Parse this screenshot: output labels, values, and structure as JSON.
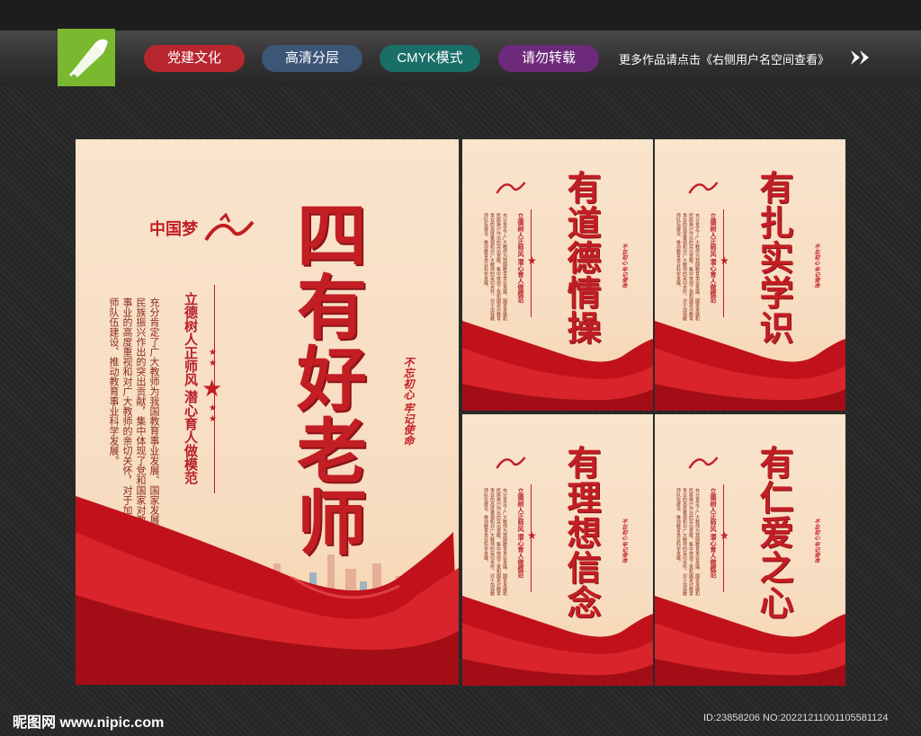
{
  "header": {
    "tags": [
      "党建文化",
      "高清分层",
      "CMYK模式",
      "请勿转载"
    ],
    "more_text": "更多作品请点击《右侧用户名空间查看》"
  },
  "main_poster": {
    "title": "四有好老师",
    "subtitle": "立德树人正师风  潜心育人做模范",
    "body": "充分肯定了广大教师为我国教育事业发展、国家发展和民族振兴作出的突出贡献，集中体现了党和国家对教育事业的高度重视和对广大教师的亲切关怀，对于加强教师队伍建设、推动教育事业科学发展。",
    "stamp": "不忘初心 牢记使命",
    "logo_text": "中国梦"
  },
  "small_posters": [
    {
      "title": "有道德情操",
      "subtitle": "立德树人正师风  潜心育人做模范",
      "stamp": "不忘初心 牢记使命"
    },
    {
      "title": "有扎实学识",
      "subtitle": "立德树人正师风  潜心育人做模范",
      "stamp": "不忘初心 牢记使命"
    },
    {
      "title": "有理想信念",
      "subtitle": "立德树人正师风  潜心育人做模范",
      "stamp": "不忘初心 牢记使命"
    },
    {
      "title": "有仁爱之心",
      "subtitle": "立德树人正师风  潜心育人做模范",
      "stamp": "不忘初心 牢记使命"
    }
  ],
  "footer": {
    "watermark": "昵图网 www.nipic.com",
    "id_text": "ID:23858206 NO:20221211001105581124"
  },
  "colors": {
    "accent_red": "#c21e24",
    "logo_green": "#7ab830",
    "poster_bg": "#f9e4cc"
  }
}
